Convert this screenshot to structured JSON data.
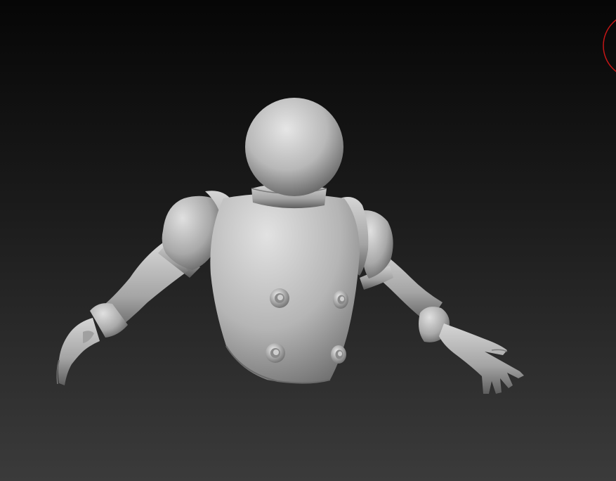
{
  "viewport": {
    "background_top": "#070707",
    "background_bottom": "#3a3a3a",
    "model_color": "#bdbdbd",
    "cursor_ring_color": "#d01818",
    "icons": [
      "navigation-ring-icon"
    ]
  },
  "model": {
    "parts": [
      "head-sphere",
      "neck-collar",
      "chest-armor",
      "left-pauldron",
      "right-pauldron",
      "left-arm",
      "right-arm",
      "left-hand",
      "right-hand",
      "rivets"
    ],
    "rivet_count": 4
  }
}
